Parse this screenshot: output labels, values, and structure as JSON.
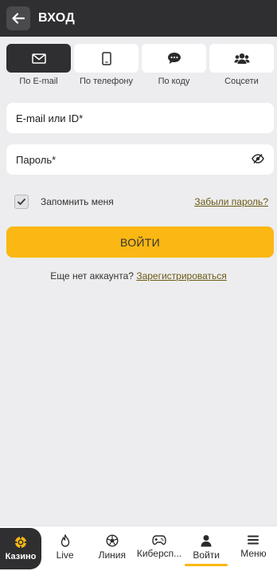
{
  "header": {
    "title": "ВХОД"
  },
  "tabs": [
    {
      "label": "По E-mail",
      "icon": "envelope-icon",
      "active": true
    },
    {
      "label": "По телефону",
      "icon": "phone-icon",
      "active": false
    },
    {
      "label": "По коду",
      "icon": "chat-icon",
      "active": false
    },
    {
      "label": "Соцсети",
      "icon": "users-icon",
      "active": false
    }
  ],
  "form": {
    "email_placeholder": "E-mail или ID*",
    "password_placeholder": "Пароль*",
    "remember_label": "Запомнить меня",
    "remember_checked": true,
    "forgot_label": "Забыли пароль?",
    "submit_label": "ВОЙТИ",
    "no_account_text": "Еще нет аккаунта?",
    "register_label": "Зарегистрироваться"
  },
  "nav": {
    "casino": "Казино",
    "items": [
      {
        "label": "Live",
        "icon": "flame-icon"
      },
      {
        "label": "Линия",
        "icon": "soccer-ball-icon"
      },
      {
        "label": "Киберсп...",
        "icon": "gamepad-icon"
      },
      {
        "label": "Войти",
        "icon": "user-icon",
        "active": true
      },
      {
        "label": "Меню",
        "icon": "hamburger-icon"
      }
    ]
  },
  "colors": {
    "accent": "#fbb713",
    "dark": "#2f2f31",
    "background": "#ededef",
    "link": "#6b5a16"
  }
}
